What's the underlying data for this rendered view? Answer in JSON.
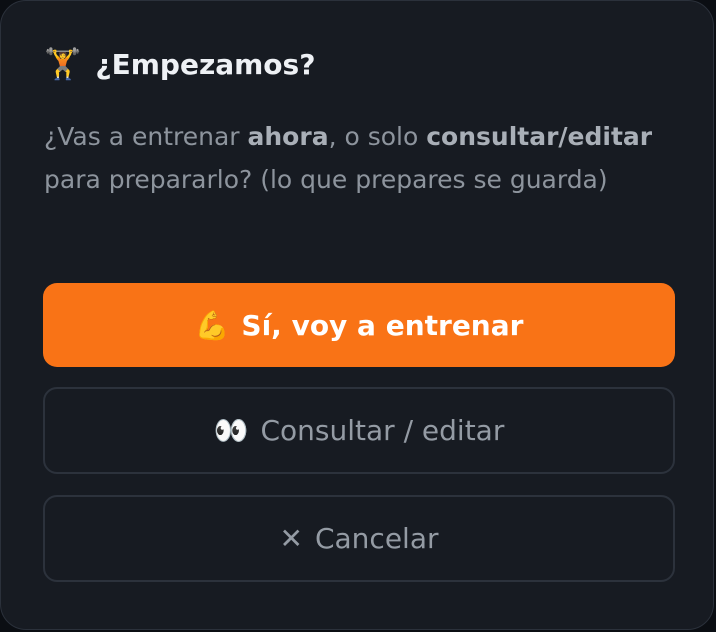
{
  "dialog": {
    "title_icon": "🏋",
    "title": "¿Empezamos?",
    "description": {
      "p1": "¿Vas a entrenar ",
      "b1": "ahora",
      "p2": ", o solo ",
      "b2": "consultar/editar",
      "p3": " para prepararlo? (lo que prepares se guarda)"
    },
    "primary_button": {
      "icon": "💪",
      "label": "Sí, voy a entrenar"
    },
    "secondary_button": {
      "icon": "👀",
      "label": "Consultar / editar"
    },
    "cancel_button": {
      "icon": "✕",
      "label": "Cancelar"
    }
  },
  "colors": {
    "dialog_background": "#171b22",
    "primary_accent": "#f97316",
    "title_text": "#eef1f5",
    "muted_text": "#8d949d"
  },
  "icons": {
    "title": "weightlifter-icon",
    "primary": "flexed-biceps-icon",
    "secondary": "eyes-icon",
    "cancel": "close-icon"
  }
}
